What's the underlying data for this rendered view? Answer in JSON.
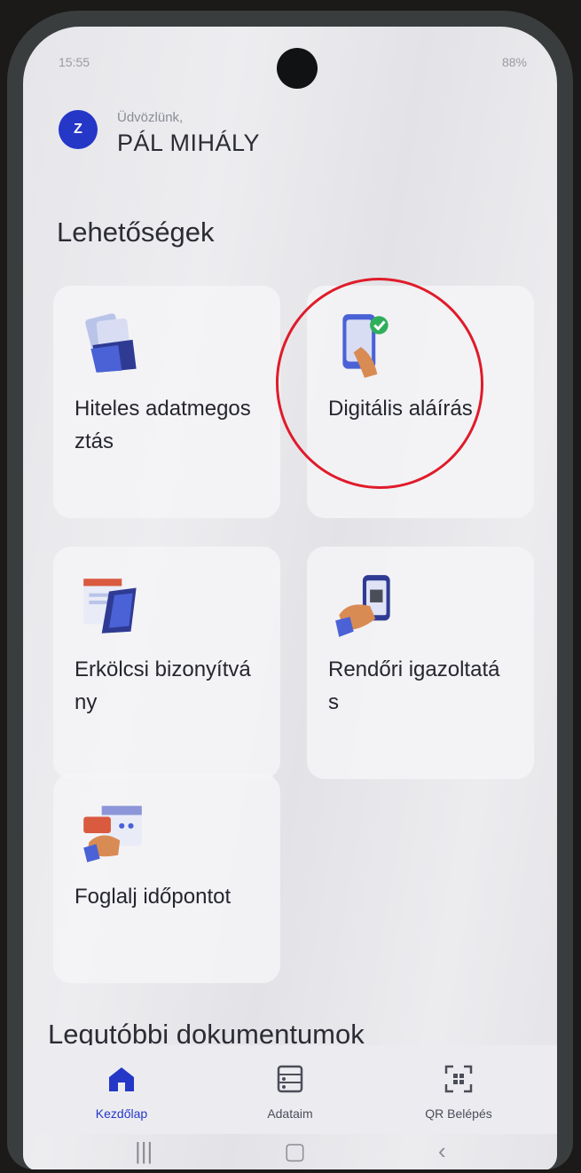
{
  "status_bar": {
    "time": "15:55",
    "battery": "88%"
  },
  "greeting": {
    "small": "Üdvözlünk,",
    "name": "PÁL MIHÁLY",
    "avatar_letter": "Z"
  },
  "section_title": "Lehetőségek",
  "cards": [
    {
      "label": "Hiteles adatmegosztás",
      "icon": "document-folder-icon"
    },
    {
      "label": "Digitális aláírás",
      "icon": "phone-signature-icon"
    },
    {
      "label": "Erkölcsi bizonyítvány",
      "icon": "certificate-icon"
    },
    {
      "label": "Rendőri igazoltatás",
      "icon": "id-phone-icon"
    },
    {
      "label": "Foglalj időpontot",
      "icon": "calendar-booking-icon"
    }
  ],
  "recent_title": "Legutóbbi dokumentumok",
  "bottom_nav": [
    {
      "label": "Kezdőlap",
      "icon": "home-icon",
      "active": true
    },
    {
      "label": "Adataim",
      "icon": "profile-list-icon",
      "active": false
    },
    {
      "label": "QR Belépés",
      "icon": "qr-scan-icon",
      "active": false
    }
  ],
  "colors": {
    "accent": "#2537c7",
    "annotation": "#e01b2a"
  }
}
